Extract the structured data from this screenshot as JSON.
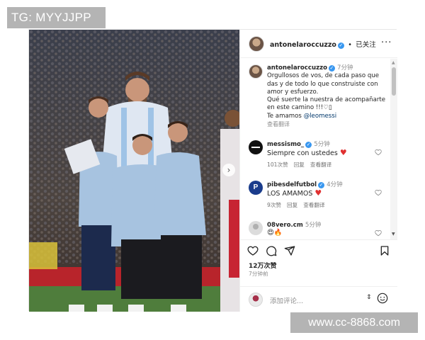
{
  "watermarks": {
    "top": "TG: MYYJJPP",
    "bottom": "www.cc-8868.com"
  },
  "header": {
    "username": "antonelaroccuzzo",
    "separator": "•",
    "follow_status": "已关注",
    "more_label": "···"
  },
  "caption": {
    "username": "antonelaroccuzzo",
    "time": "7分钟",
    "text": "Orgullosos de vos, de cada paso que das y de todo lo que construiste  con amor y esfuerzo.",
    "text2": "Qué suerte la nuestra de acompañarte en este camino !!!",
    "text3": "Te amamos",
    "mention": "@leomessi",
    "translate": "查看翻译"
  },
  "comments": [
    {
      "username": "messismo_",
      "time": "5分钟",
      "text": "Siempre con ustedes",
      "likes": "101次赞",
      "reply": "回复",
      "translate": "查看翻译"
    },
    {
      "username": "pibesdelfutbol",
      "time": "4分钟",
      "text": "LOS AMAMOS",
      "likes": "9次赞",
      "reply": "回复",
      "translate": "查看翻译"
    },
    {
      "username": "08vero.cm",
      "time": "5分钟",
      "text": "😍🔥"
    }
  ],
  "post": {
    "likes_count": "12万次赞",
    "posted_ago": "7分钟前",
    "add_comment_placeholder": "添加评论...",
    "emoji_label": "⇕"
  },
  "icons": {
    "verified": "verified-badge-icon",
    "heart": "heart-icon",
    "comment": "comment-icon",
    "share": "share-icon",
    "save": "bookmark-icon",
    "emoji": "smiley-icon",
    "next": "chevron-right-icon"
  },
  "colors": {
    "verified_blue": "#3897f0",
    "like_red": "#e03131",
    "watermark_grey": "#b4b4b4"
  }
}
